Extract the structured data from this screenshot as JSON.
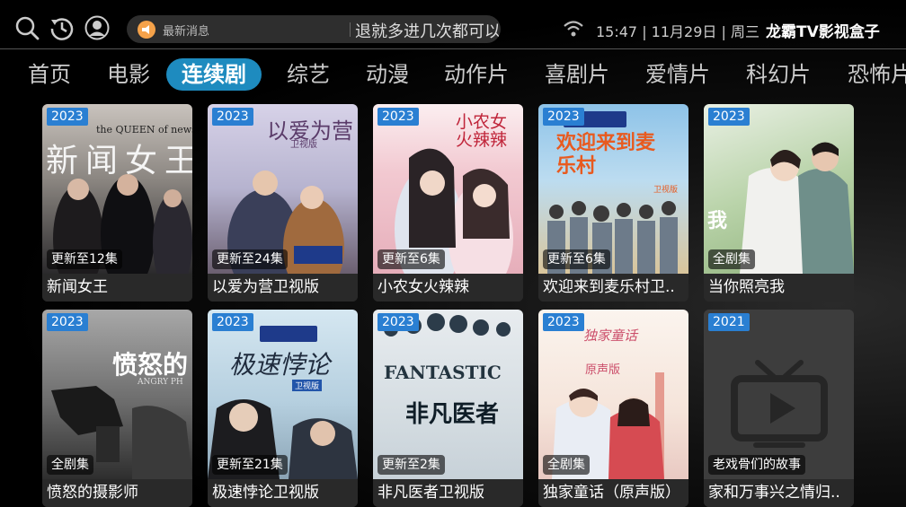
{
  "header": {
    "notice_label": "最新消息",
    "notice_text": "退就多进几次都可以了》（提示点",
    "time": "15:47",
    "date": "11月29日",
    "weekday": "周三",
    "app_title": "龙霸TV影视盒子"
  },
  "tabs": [
    {
      "label": "首页"
    },
    {
      "label": "电影"
    },
    {
      "label": "连续剧",
      "active": true
    },
    {
      "label": "综艺"
    },
    {
      "label": "动漫"
    },
    {
      "label": "动作片"
    },
    {
      "label": "喜剧片"
    },
    {
      "label": "爱情片"
    },
    {
      "label": "科幻片"
    },
    {
      "label": "恐怖片"
    }
  ],
  "cards": [
    {
      "year": "2023",
      "episodes": "更新至12集",
      "title": "新闻女王",
      "poster_text": "新闻女王",
      "poster_sub": "the QUEEN of news"
    },
    {
      "year": "2023",
      "episodes": "更新至24集",
      "title": "以爱为营卫视版",
      "poster_text": "以爱为营",
      "poster_sub": "卫视版"
    },
    {
      "year": "2023",
      "episodes": "更新至6集",
      "title": "小农女火辣辣",
      "poster_text": "小农女火辣辣",
      "poster_sub": ""
    },
    {
      "year": "2023",
      "episodes": "更新至6集",
      "title": "欢迎来到麦乐村卫..",
      "poster_text": "欢迎来到麦乐村",
      "poster_sub": "卫视版"
    },
    {
      "year": "2023",
      "episodes": "全剧集",
      "title": "当你照亮我",
      "poster_text": "我",
      "poster_sub": ""
    },
    {
      "year": "2023",
      "episodes": "全剧集",
      "title": "愤怒的摄影师",
      "poster_text": "愤怒的",
      "poster_sub": "ANGRY PH"
    },
    {
      "year": "2023",
      "episodes": "更新至21集",
      "title": "极速悖论卫视版",
      "poster_text": "极速悖论",
      "poster_sub": "卫视版"
    },
    {
      "year": "2023",
      "episodes": "更新至2集",
      "title": "非凡医者卫视版",
      "poster_text": "非凡医者",
      "poster_sub": "FANTASTIC"
    },
    {
      "year": "2023",
      "episodes": "全剧集",
      "title": "独家童话（原声版）",
      "poster_text": "独家童话",
      "poster_sub": "原声版"
    },
    {
      "year": "2021",
      "episodes": "老戏骨们的故事",
      "title": "家和万事兴之情归..",
      "poster_text": "",
      "poster_sub": ""
    }
  ],
  "colors": {
    "accent": "#1e8bbf",
    "year_badge": "#2a7fd2",
    "notice_icon": "#f5a24a"
  },
  "icons": [
    "search-icon",
    "history-icon",
    "user-icon",
    "megaphone-icon",
    "wifi-icon",
    "tv-icon"
  ]
}
